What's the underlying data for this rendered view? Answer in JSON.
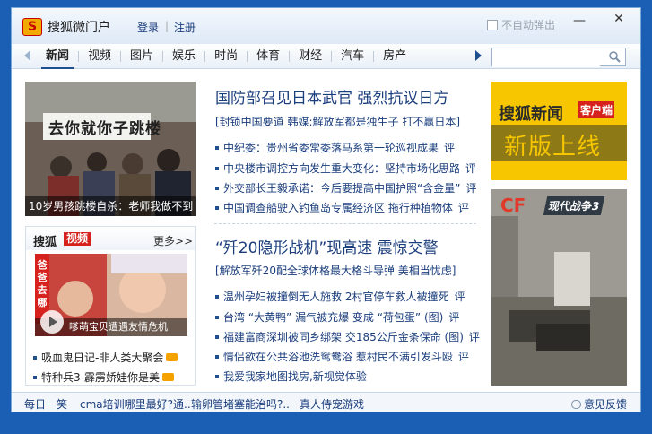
{
  "window": {
    "app_title": "搜狐微门户",
    "login": "登录",
    "separator": "|",
    "register": "注册",
    "auto_popup_label": "不自动弹出",
    "minimize": "—",
    "close": "✕"
  },
  "nav": {
    "tabs": [
      "新闻",
      "视频",
      "图片",
      "娱乐",
      "时尚",
      "体育",
      "财经",
      "汽车",
      "房产"
    ],
    "active_tab": "新闻",
    "search_placeholder": ""
  },
  "hero": {
    "banner_text": "去你就你子跳楼",
    "caption": "10岁男孩跳楼自杀：老师我做不到"
  },
  "video": {
    "brand": "搜狐",
    "tag": "视频",
    "more": "更多>>",
    "badge": "爸爸去哪",
    "caption": "嗲萌宝贝遭遇友情危机",
    "items": [
      "吸血鬼日记-非人类大聚会",
      "特种兵3-霹雳娇娃你是美"
    ]
  },
  "news_block_1": {
    "headline": "国防部召见日本武官  强烈抗议日方",
    "sub": "[封锁中国要道  韩媒:解放军都是独生子  打不赢日本]",
    "items": [
      {
        "text": "中纪委：贵州省委常委落马系第一轮巡视成果",
        "comment": "评"
      },
      {
        "text": "中央楼市调控方向发生重大变化：坚持市场化思路",
        "comment": "评"
      },
      {
        "text": "外交部长王毅承诺：今后要提高中国护照“含金量”",
        "comment": "评"
      },
      {
        "text": "中国调查船驶入钓鱼岛专属经济区  拖行种植物体",
        "comment": "评"
      }
    ]
  },
  "news_block_2": {
    "headline": "“歼20隐形战机”现高速  震惊交警",
    "sub": "[解放军歼20配全球体格最大格斗导弹  美相当忧虑]",
    "items": [
      {
        "text": "温州孕妇被撞倒无人施救  2村官停车救人被撞死",
        "comment": "评"
      },
      {
        "text": "台湾 “大黄鸭” 漏气被充爆  变成 “荷包蛋”  (图)",
        "comment": "评"
      },
      {
        "text": "福建富商深圳被同乡绑架  交185公斤金条保命  (图)",
        "comment": "评"
      },
      {
        "text": "情侣欲在公共浴池洗鸳鸯浴  惹村民不满引发斗殴",
        "comment": "评"
      },
      {
        "text": "我爱我家地图找房,新视觉体验",
        "comment": ""
      }
    ]
  },
  "ad1": {
    "brand": "搜狐新闻",
    "tag": "客户端",
    "slogan": "新版上线"
  },
  "ad2": {
    "logo": "CF",
    "title": "现代战争3"
  },
  "footer": {
    "links": [
      "每日一笑",
      "cma培训哪里最好?通..",
      "输卵管堵塞能治吗?..",
      "真人侍宠游戏"
    ],
    "feedback": "意见反馈"
  }
}
